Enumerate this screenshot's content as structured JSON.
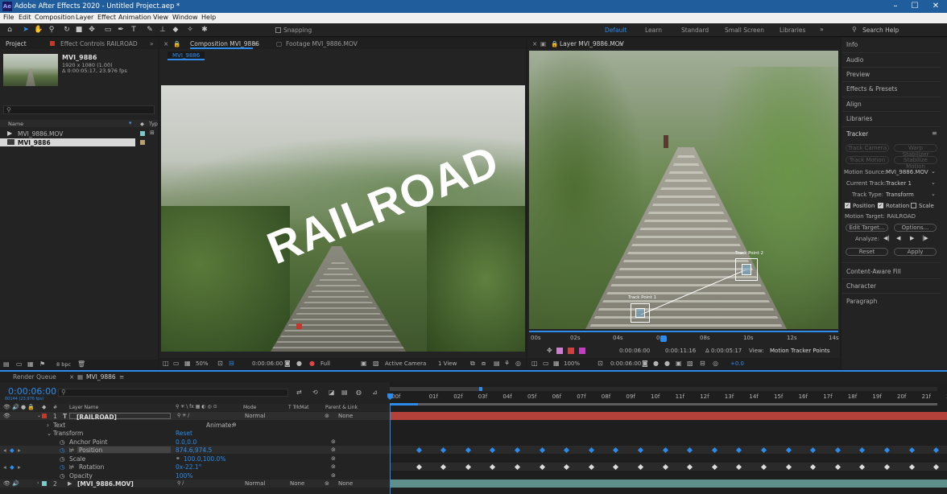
{
  "titlebar": {
    "logo": "Ae",
    "title": "Adobe After Effects 2020 - Untitled Project.aep *",
    "min": "–",
    "max": "☐",
    "close": "✕"
  },
  "menu": [
    "File",
    "Edit",
    "Composition",
    "Layer",
    "Effect",
    "Animation",
    "View",
    "Window",
    "Help"
  ],
  "toolbar": {
    "snapping_label": "Snapping",
    "workspaces": [
      "Default",
      "Learn",
      "Standard",
      "Small Screen",
      "Libraries"
    ],
    "search_placeholder": "Search Help"
  },
  "project": {
    "tab": "Project",
    "effect_tab": "Effect Controls RAILROAD",
    "item_name": "MVI_9886",
    "item_info1": "1920 x 1080 (1.00)",
    "item_info2": "Δ 0:00:05:17, 23.976 fps",
    "col_name": "Name",
    "col_type": "Typ",
    "files": [
      {
        "name": "MVI_9886.MOV",
        "type": "footage"
      },
      {
        "name": "MVI_9886",
        "type": "comp"
      }
    ],
    "bpc": "8 bpc"
  },
  "comp": {
    "tab": "Composition MVI_9886",
    "footage_tab": "Footage MVI_9886.MOV",
    "breadcrumb": "MVI_9886",
    "overlay_text": "RAILROAD",
    "zoom": "50%",
    "time": "0:00:06:00",
    "resolution": "Full",
    "camera": "Active Camera",
    "views": "1 View"
  },
  "layer": {
    "tab": "Layer MVI_9886.MOV",
    "track_point1": "Track Point 1",
    "track_point2": "Track Point 2",
    "ruler": [
      "00s",
      "02s",
      "04s",
      "06s",
      "08s",
      "10s",
      "12s",
      "14s"
    ],
    "time_in": "0:00:06:00",
    "time_out": "0:00:11:16",
    "duration": "Δ 0:00:05:17",
    "view_label": "View:",
    "view_value": "Motion Tracker Points",
    "zoom": "100%",
    "time": "0:00:06:00",
    "exposure": "+0.0"
  },
  "right": {
    "items": [
      "Info",
      "Audio",
      "Preview",
      "Effects & Presets",
      "Align",
      "Libraries",
      "Tracker",
      "Content-Aware Fill",
      "Character",
      "Paragraph"
    ],
    "track_camera": "Track Camera",
    "warp_stabilizer": "Warp Stabilizer",
    "track_motion": "Track Motion",
    "stabilize_motion": "Stabilize Motion",
    "motion_source_label": "Motion Source:",
    "motion_source": "MVI_9886.MOV",
    "current_track_label": "Current Track:",
    "current_track": "Tracker 1",
    "track_type_label": "Track Type:",
    "track_type": "Transform",
    "position": "Position",
    "rotation": "Rotation",
    "scale": "Scale",
    "position_checked": true,
    "rotation_checked": true,
    "scale_checked": false,
    "motion_target": "Motion Target: RAILROAD",
    "edit_target": "Edit Target...",
    "options": "Options...",
    "analyze": "Analyze:",
    "reset": "Reset",
    "apply": "Apply"
  },
  "timeline": {
    "render_queue": "Render Queue",
    "comp_tab": "MVI_9886",
    "timecode": "0:00:06:00",
    "frames": "00144 (23.976 fps)",
    "col_num": "#",
    "col_layer": "Layer Name",
    "col_mode": "Mode",
    "col_trkmat": "T TrkMat",
    "col_parent": "Parent & Link",
    "layer1_num": "1",
    "layer1_name": "[RAILROAD]",
    "layer1_mode": "Normal",
    "layer1_parent": "None",
    "text_label": "Text",
    "animate_label": "Animate:",
    "transform_label": "Transform",
    "reset_label": "Reset",
    "anchor_label": "Anchor Point",
    "anchor_value": "0.0,0.0",
    "position_label": "Position",
    "position_value": "874.6,974.5",
    "scale_label": "Scale",
    "scale_value": "100.0,100.0%",
    "rotation_label": "Rotation",
    "rotation_value": "0x-22.1°",
    "opacity_label": "Opacity",
    "opacity_value": "100%",
    "layer2_num": "2",
    "layer2_name": "[MVI_9886.MOV]",
    "layer2_mode": "Normal",
    "layer2_trkmat": "None",
    "layer2_parent": "None",
    "ruler": [
      "00f",
      "01f",
      "02f",
      "03f",
      "04f",
      "05f",
      "06f",
      "07f",
      "08f",
      "09f",
      "10f",
      "11f",
      "12f",
      "13f",
      "14f",
      "15f",
      "16f",
      "17f",
      "18f",
      "19f",
      "20f",
      "21f",
      "22"
    ]
  },
  "colors": {
    "accent": "#2d8ceb",
    "title_bar": "#1f5d9c",
    "text_layer_bar": "#b5423a",
    "video_layer_bar": "#5e8f8a",
    "label_red": "#c0392b"
  }
}
